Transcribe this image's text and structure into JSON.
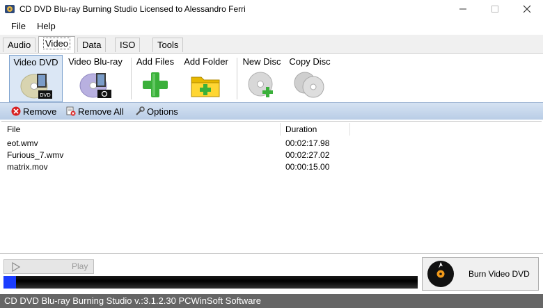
{
  "window": {
    "title": "CD DVD Blu-ray Burning Studio Licensed to Alessandro Ferri",
    "minimize_icon": "minimize-icon",
    "maximize_icon": "maximize-icon",
    "close_icon": "close-icon"
  },
  "menu": {
    "items": [
      "File",
      "Help"
    ]
  },
  "tabs": {
    "items": [
      "Audio",
      "Video",
      "Data",
      "ISO",
      "Tools"
    ],
    "active": "Video"
  },
  "ribbon": {
    "buttons": [
      "Video DVD",
      "Video Blu-ray",
      "Add Files",
      "Add Folder",
      "New Disc",
      "Copy Disc"
    ],
    "selected": "Video DVD",
    "dvd_badge": "DVD"
  },
  "actions": {
    "remove": "Remove",
    "remove_all": "Remove All",
    "options": "Options"
  },
  "list": {
    "columns": [
      "File",
      "Duration"
    ],
    "rows": [
      {
        "file": "eot.wmv",
        "duration": "00:02:17.98"
      },
      {
        "file": "Furious_7.wmv",
        "duration": "00:02:27.02"
      },
      {
        "file": "matrix.mov",
        "duration": "00:00:15.00"
      }
    ]
  },
  "player": {
    "play_label": "Play",
    "progress_fraction": 0.03
  },
  "burn": {
    "label": "Burn Video DVD"
  },
  "status": {
    "text": "CD DVD Blu-ray Burning Studio v.:3.1.2.30 PCWinSoft Software"
  },
  "colors": {
    "accent": "#1a3cff",
    "ribbon_selected": "#dbe7f5",
    "status_bg": "#666666"
  }
}
